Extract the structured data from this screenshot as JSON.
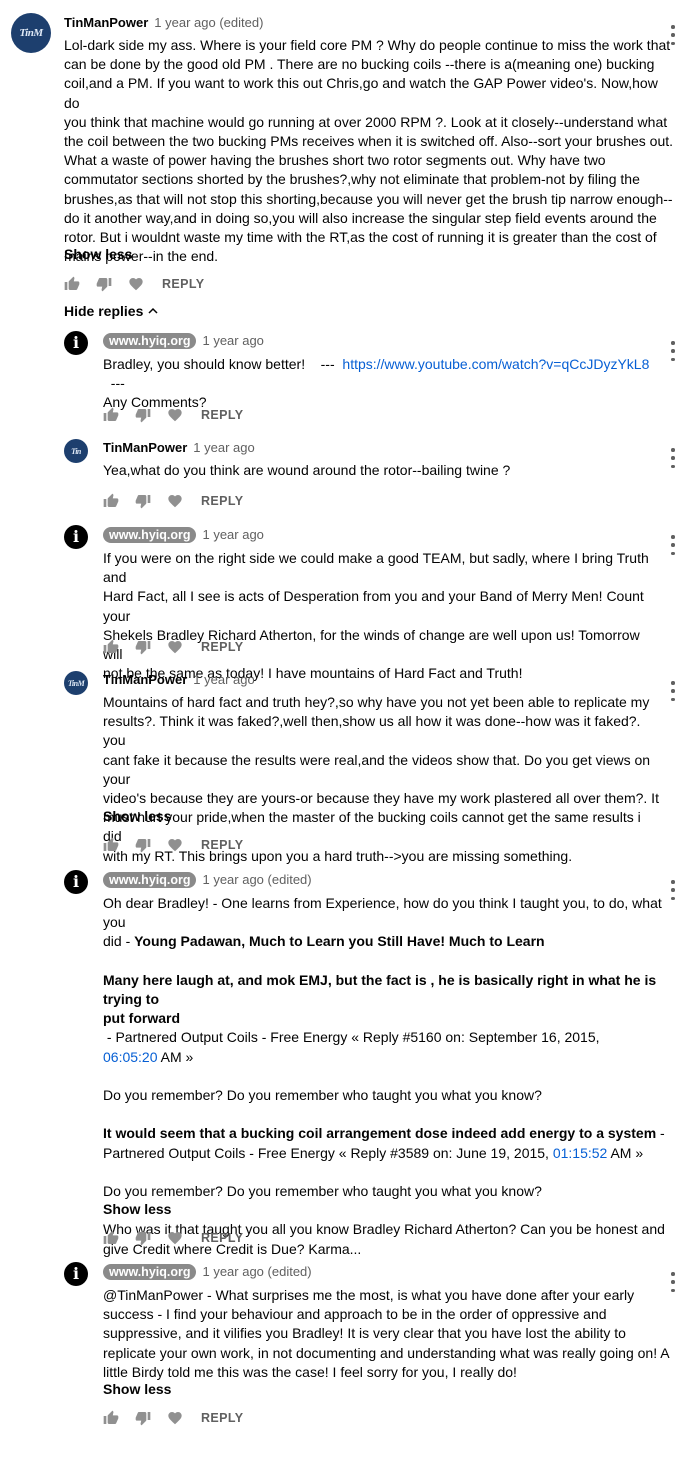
{
  "main_comment": {
    "author": "TinManPower",
    "time": "1 year ago (edited)",
    "avatar_text": "TinM",
    "lines": [
      "Lol-dark side my ass.  Where is your field core PM ? Why do people continue to miss the work that",
      "can be done by the good old PM . There are no bucking coils --there is a(meaning one) bucking",
      "coil,and a PM. If you want to work this out Chris,go and watch the  GAP Power video's. Now,how do",
      "you think that machine would go running at over 2000 RPM ?. Look at it closely--understand what",
      "the coil between the two bucking PMs receives when it is switched off. Also--sort your brushes out.",
      "What a waste of power having the brushes short two rotor segments out. Why have two",
      "commutator sections shorted by the brushes?,why not eliminate that problem-not by filing the",
      "brushes,as that will not stop this shorting,because you will never get the brush tip narrow enough--",
      "do it another way,and in doing so,you will also increase the  singular step field events around the",
      "rotor.  But i wouldnt waste my time with the RT,as the cost of running it is greater than the cost of",
      "mains power--in the end."
    ],
    "show_less": "Show less",
    "reply": "REPLY"
  },
  "hide_replies": "Hide replies",
  "replies": [
    {
      "author": "www.hyiq.org",
      "time": "1 year ago",
      "line1_pre": "Bradley, you should know better!    ---  ",
      "line1_link": "https://www.youtube.com/watch?v=qCcJDyzYkL8",
      "line1_post": "  ---",
      "line2": "Any Comments?",
      "reply": "REPLY"
    },
    {
      "author": "TinManPower",
      "time": "1 year ago",
      "avatar_text": "Tin",
      "line1": "Yea,what do you think are wound around the rotor--bailing twine ?",
      "reply": "REPLY"
    },
    {
      "author": "www.hyiq.org",
      "time": "1 year ago",
      "lines": [
        "If you were on the right side we could make a good TEAM, but sadly, where I bring Truth and",
        "Hard Fact, all I see is acts of Desperation from you and your Band of Merry Men! Count your",
        "Shekels Bradley Richard Atherton, for the winds of change are well upon us! Tomorrow will",
        "not be the same as today! I have mountains of Hard Fact and Truth!"
      ],
      "reply": "REPLY"
    },
    {
      "author": "TinManPower",
      "time": "1 year ago",
      "avatar_text": "TinM",
      "lines": [
        "Mountains of hard fact and truth hey?,so why have you not yet been able to replicate my",
        "results?. Think it was faked?,well then,show us all how it was done--how was it faked?. you",
        "cant fake it because the results were real,and the videos show that. Do you get views on your",
        "video's because they are yours-or because they have my work plastered all over them?.  It",
        "must hurt your pride,when the master of the bucking coils cannot get the same results i did",
        "with my RT. This brings upon you a hard truth-->you are missing something."
      ],
      "show_less": "Show less",
      "reply": "REPLY"
    },
    {
      "author": "www.hyiq.org",
      "time": "1 year ago (edited)",
      "p1_line1": "Oh dear Bradley! - One learns from Experience, how do you think I taught you, to do, what you",
      "p1_line2_pre": "did - ",
      "p1_line2_bold": "Young Padawan, Much to Learn you Still Have! Much to Learn",
      "q1_line1_bold": "Many here laugh at, and mok EMJ, but the fact is , he is basically right in what he is trying to",
      "q1_line2_bold": "put forward",
      "q1_line2_rest": " - Partnered Output Coils - Free Energy « Reply #5160 on: September 16, 2015,",
      "q1_line3_link": "06:05:20",
      "q1_line3_rest": " AM »",
      "remember1": "Do you remember? Do you remember who taught you what you know?",
      "q2_line1_bold": "It would seem that a bucking coil arrangement dose indeed add energy to a system",
      "q2_line1_rest": " -",
      "q2_line2_pre": "Partnered Output Coils - Free Energy « Reply #3589 on: June 19, 2015, ",
      "q2_line2_link": "01:15:52",
      "q2_line2_post": " AM »",
      "remember2": "Do you remember? Do you remember who taught you what you know?",
      "last_line1": "Who was it that taught you all you know Bradley Richard Atherton? Can you be honest and",
      "last_line2": "give Credit where Credit is Due? Karma...",
      "show_less": "Show less",
      "reply": "REPLY"
    },
    {
      "author": "www.hyiq.org",
      "time": "1 year ago (edited)",
      "lines": [
        "@TinManPower - What surprises me the most, is what you have done after your early",
        "success - I find your behaviour and approach to be in the order of oppressive and",
        "suppressive, and it vilifies you Bradley! It is very clear that you have lost the ability to",
        "replicate your own work, in not documenting and understanding what was really going on! A",
        "little Birdy told me this was the case! I feel sorry for you, I really do!"
      ],
      "show_less": "Show less",
      "reply": "REPLY"
    }
  ],
  "icons": {
    "like": "thumbs-up-icon",
    "dislike": "thumbs-down-icon",
    "heart": "heart-icon",
    "menu": "more-vert-icon",
    "chevron": "chevron-up-icon",
    "hyiq_avatar": "info-icon"
  }
}
